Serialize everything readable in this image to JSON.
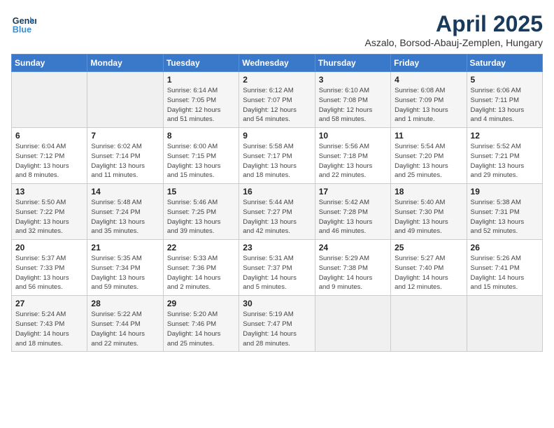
{
  "logo": {
    "line1": "General",
    "line2": "Blue"
  },
  "title": "April 2025",
  "location": "Aszalo, Borsod-Abauj-Zemplen, Hungary",
  "days_of_week": [
    "Sunday",
    "Monday",
    "Tuesday",
    "Wednesday",
    "Thursday",
    "Friday",
    "Saturday"
  ],
  "weeks": [
    [
      {
        "day": "",
        "info": ""
      },
      {
        "day": "",
        "info": ""
      },
      {
        "day": "1",
        "info": "Sunrise: 6:14 AM\nSunset: 7:05 PM\nDaylight: 12 hours\nand 51 minutes."
      },
      {
        "day": "2",
        "info": "Sunrise: 6:12 AM\nSunset: 7:07 PM\nDaylight: 12 hours\nand 54 minutes."
      },
      {
        "day": "3",
        "info": "Sunrise: 6:10 AM\nSunset: 7:08 PM\nDaylight: 12 hours\nand 58 minutes."
      },
      {
        "day": "4",
        "info": "Sunrise: 6:08 AM\nSunset: 7:09 PM\nDaylight: 13 hours\nand 1 minute."
      },
      {
        "day": "5",
        "info": "Sunrise: 6:06 AM\nSunset: 7:11 PM\nDaylight: 13 hours\nand 4 minutes."
      }
    ],
    [
      {
        "day": "6",
        "info": "Sunrise: 6:04 AM\nSunset: 7:12 PM\nDaylight: 13 hours\nand 8 minutes."
      },
      {
        "day": "7",
        "info": "Sunrise: 6:02 AM\nSunset: 7:14 PM\nDaylight: 13 hours\nand 11 minutes."
      },
      {
        "day": "8",
        "info": "Sunrise: 6:00 AM\nSunset: 7:15 PM\nDaylight: 13 hours\nand 15 minutes."
      },
      {
        "day": "9",
        "info": "Sunrise: 5:58 AM\nSunset: 7:17 PM\nDaylight: 13 hours\nand 18 minutes."
      },
      {
        "day": "10",
        "info": "Sunrise: 5:56 AM\nSunset: 7:18 PM\nDaylight: 13 hours\nand 22 minutes."
      },
      {
        "day": "11",
        "info": "Sunrise: 5:54 AM\nSunset: 7:20 PM\nDaylight: 13 hours\nand 25 minutes."
      },
      {
        "day": "12",
        "info": "Sunrise: 5:52 AM\nSunset: 7:21 PM\nDaylight: 13 hours\nand 29 minutes."
      }
    ],
    [
      {
        "day": "13",
        "info": "Sunrise: 5:50 AM\nSunset: 7:22 PM\nDaylight: 13 hours\nand 32 minutes."
      },
      {
        "day": "14",
        "info": "Sunrise: 5:48 AM\nSunset: 7:24 PM\nDaylight: 13 hours\nand 35 minutes."
      },
      {
        "day": "15",
        "info": "Sunrise: 5:46 AM\nSunset: 7:25 PM\nDaylight: 13 hours\nand 39 minutes."
      },
      {
        "day": "16",
        "info": "Sunrise: 5:44 AM\nSunset: 7:27 PM\nDaylight: 13 hours\nand 42 minutes."
      },
      {
        "day": "17",
        "info": "Sunrise: 5:42 AM\nSunset: 7:28 PM\nDaylight: 13 hours\nand 46 minutes."
      },
      {
        "day": "18",
        "info": "Sunrise: 5:40 AM\nSunset: 7:30 PM\nDaylight: 13 hours\nand 49 minutes."
      },
      {
        "day": "19",
        "info": "Sunrise: 5:38 AM\nSunset: 7:31 PM\nDaylight: 13 hours\nand 52 minutes."
      }
    ],
    [
      {
        "day": "20",
        "info": "Sunrise: 5:37 AM\nSunset: 7:33 PM\nDaylight: 13 hours\nand 56 minutes."
      },
      {
        "day": "21",
        "info": "Sunrise: 5:35 AM\nSunset: 7:34 PM\nDaylight: 13 hours\nand 59 minutes."
      },
      {
        "day": "22",
        "info": "Sunrise: 5:33 AM\nSunset: 7:36 PM\nDaylight: 14 hours\nand 2 minutes."
      },
      {
        "day": "23",
        "info": "Sunrise: 5:31 AM\nSunset: 7:37 PM\nDaylight: 14 hours\nand 5 minutes."
      },
      {
        "day": "24",
        "info": "Sunrise: 5:29 AM\nSunset: 7:38 PM\nDaylight: 14 hours\nand 9 minutes."
      },
      {
        "day": "25",
        "info": "Sunrise: 5:27 AM\nSunset: 7:40 PM\nDaylight: 14 hours\nand 12 minutes."
      },
      {
        "day": "26",
        "info": "Sunrise: 5:26 AM\nSunset: 7:41 PM\nDaylight: 14 hours\nand 15 minutes."
      }
    ],
    [
      {
        "day": "27",
        "info": "Sunrise: 5:24 AM\nSunset: 7:43 PM\nDaylight: 14 hours\nand 18 minutes."
      },
      {
        "day": "28",
        "info": "Sunrise: 5:22 AM\nSunset: 7:44 PM\nDaylight: 14 hours\nand 22 minutes."
      },
      {
        "day": "29",
        "info": "Sunrise: 5:20 AM\nSunset: 7:46 PM\nDaylight: 14 hours\nand 25 minutes."
      },
      {
        "day": "30",
        "info": "Sunrise: 5:19 AM\nSunset: 7:47 PM\nDaylight: 14 hours\nand 28 minutes."
      },
      {
        "day": "",
        "info": ""
      },
      {
        "day": "",
        "info": ""
      },
      {
        "day": "",
        "info": ""
      }
    ]
  ]
}
